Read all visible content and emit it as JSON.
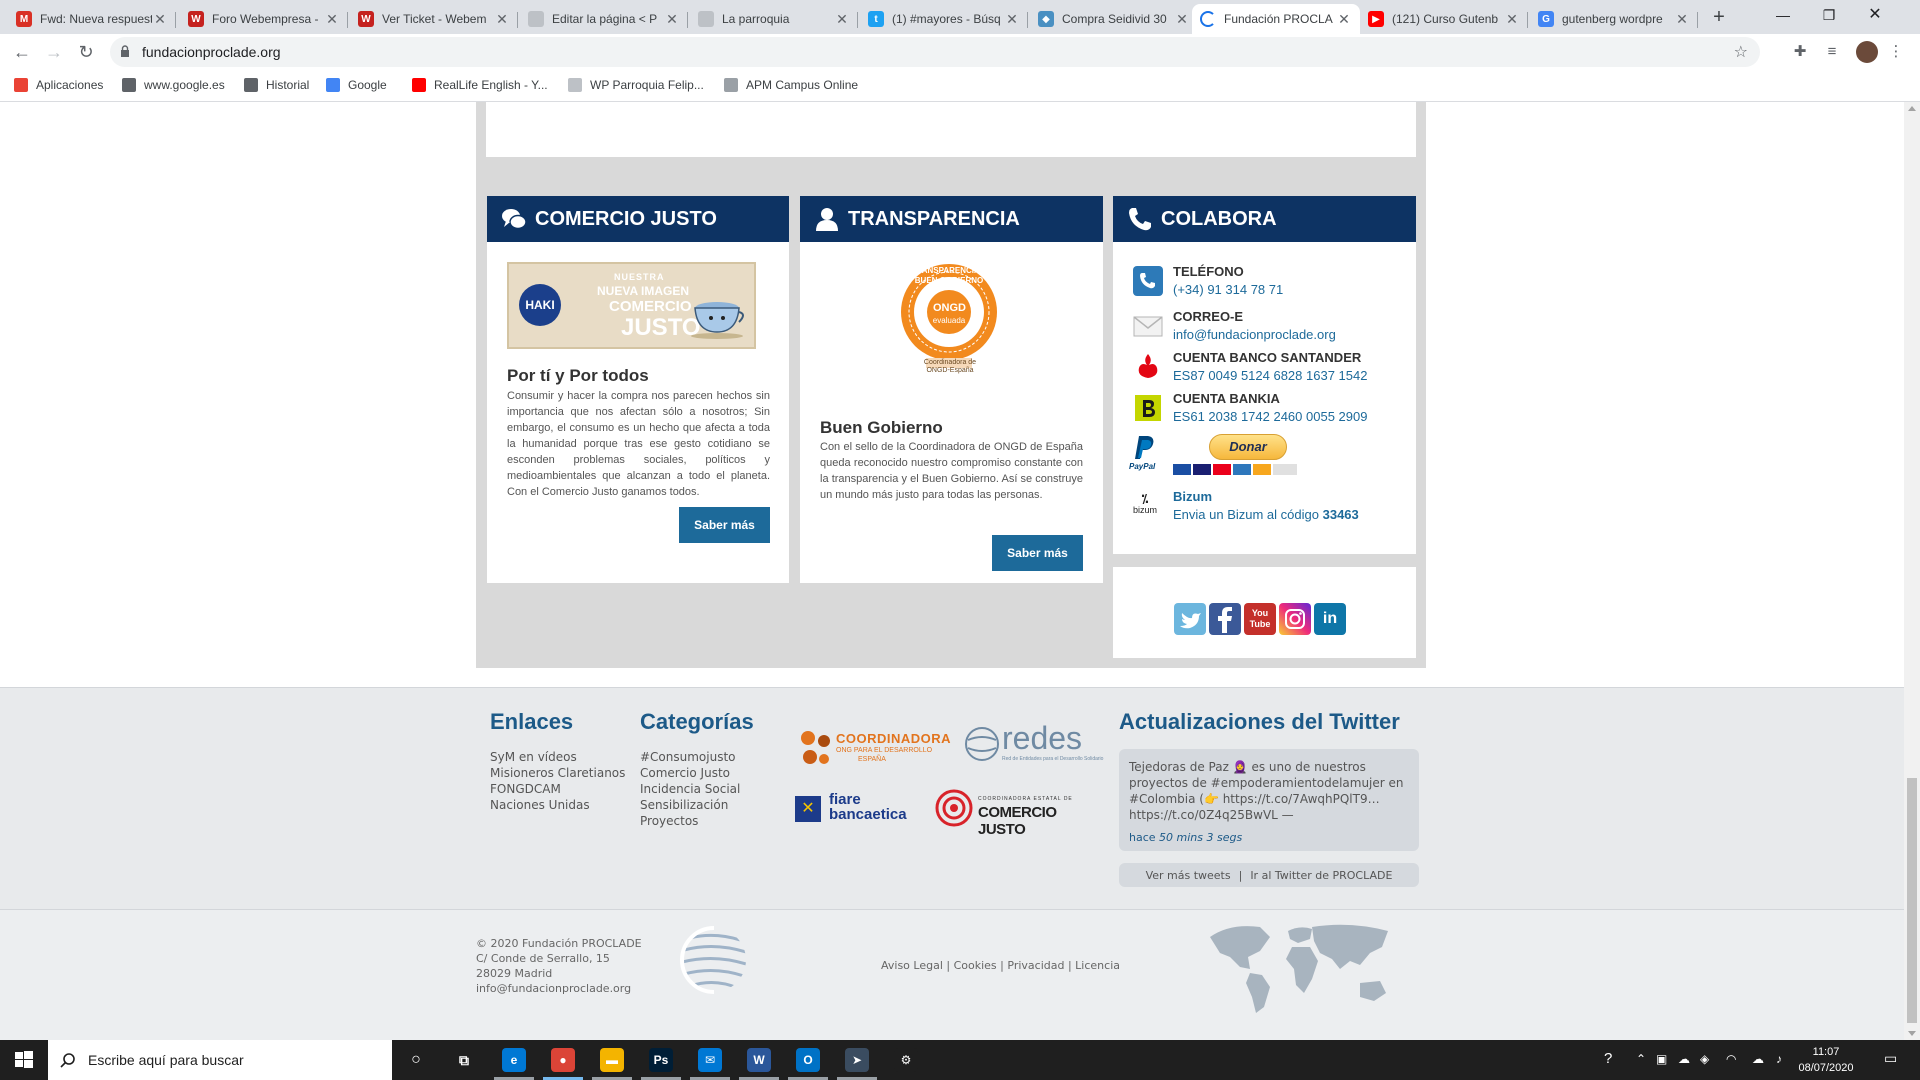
{
  "browser": {
    "tabs": [
      {
        "title": "Fwd: Nueva respuesta",
        "icon": "gmail-icon",
        "color": "#d93025",
        "glyph": "M"
      },
      {
        "title": "Foro Webempresa -",
        "icon": "webempresa-icon",
        "color": "#c5221f",
        "glyph": "W"
      },
      {
        "title": "Ver Ticket - Webem",
        "icon": "webempresa-icon",
        "color": "#c5221f",
        "glyph": "W"
      },
      {
        "title": "Editar la página < P",
        "icon": "page-icon",
        "color": "#bdc1c6",
        "glyph": ""
      },
      {
        "title": "La parroquia",
        "icon": "page-icon",
        "color": "#bdc1c6",
        "glyph": ""
      },
      {
        "title": "(1) #mayores - Búsq",
        "icon": "twitter-icon",
        "color": "#1da1f2",
        "glyph": "t"
      },
      {
        "title": "Compra Seidivid 30",
        "icon": "diamond-icon",
        "color": "#4a90c2",
        "glyph": "◆"
      },
      {
        "title": "Fundación PROCLA",
        "icon": "loading-icon",
        "color": "#ffffff",
        "glyph": "",
        "active": true
      },
      {
        "title": "(121) Curso Gutenb",
        "icon": "youtube-icon",
        "color": "#ff0000",
        "glyph": "▶"
      },
      {
        "title": "gutenberg wordpre",
        "icon": "google-icon",
        "color": "#4285f4",
        "glyph": "G"
      }
    ],
    "url": "fundacionproclade.org",
    "bookmarks": [
      {
        "label": "Aplicaciones",
        "icon": "apps-icon",
        "color": "#ea4335"
      },
      {
        "label": "www.google.es",
        "icon": "globe-icon",
        "color": "#5f6368"
      },
      {
        "label": "Historial",
        "icon": "history-icon",
        "color": "#5f6368"
      },
      {
        "label": "Google",
        "icon": "google-icon",
        "color": "#4285f4"
      },
      {
        "label": "RealLife English - Y...",
        "icon": "youtube-icon",
        "color": "#ff0000"
      },
      {
        "label": "WP Parroquia Felip...",
        "icon": "page-icon",
        "color": "#bdc1c6"
      },
      {
        "label": "APM Campus Online",
        "icon": "campus-icon",
        "color": "#9aa0a6"
      }
    ]
  },
  "cards": {
    "comercio": {
      "heading": "COMERCIO JUSTO",
      "banner_small": "NUESTRA",
      "banner_mid": "NUEVA IMAGEN",
      "banner_big": "COMERCIO",
      "banner_big2": "JUSTO",
      "banner_brand": "HAKI",
      "title": "Por tí y Por todos",
      "text": "Consumir y hacer la compra nos parecen hechos sin importancia que nos afectan sólo a nosotros; Sin embargo, el consumo es un hecho que afecta a toda la humanidad porque tras ese gesto cotidiano se esconden problemas sociales, políticos y medioambientales que alcanzan a todo el planeta. Con el Comercio Justo ganamos todos.",
      "button": "Saber más"
    },
    "transparencia": {
      "heading": "TRANSPARENCIA",
      "seal_ring": "TRANSPARENCIA Y BUEN GOBIERNO",
      "seal_center": "ONGD",
      "seal_center2": "evaluada",
      "seal_caption": "Coordinadora de ONGD-España",
      "title": "Buen Gobierno",
      "text": "Con el sello de la Coordinadora de ONGD de España queda reconocido nuestro compromiso constante con la transparencia y el Buen Gobierno. Así se construye un mundo más justo para todas las personas.",
      "button": "Saber más"
    },
    "colabora": {
      "heading": "COLABORA",
      "items": [
        {
          "label": "TELÉFONO",
          "value": "(+34) 91 314 78 71"
        },
        {
          "label": "CORREO-E",
          "value": "info@fundacionproclade.org"
        },
        {
          "label": "CUENTA BANCO SANTANDER",
          "value": "ES87 0049 5124 6828 1637 1542"
        },
        {
          "label": "CUENTA BANKIA",
          "value": "ES61 2038 1742 2460 0055 2909"
        }
      ],
      "paypal_label": "PayPal",
      "donate_button": "Donar",
      "bizum_label": "Bizum",
      "bizum_icon_text": "bizum",
      "bizum_text": "Envia un Bizum al código",
      "bizum_code": "33463"
    }
  },
  "social": [
    "twitter-icon",
    "facebook-icon",
    "youtube-icon",
    "instagram-icon",
    "linkedin-icon"
  ],
  "social_glyphs": {
    "youtube": "You Tube",
    "linkedin": "in"
  },
  "footer": {
    "enlaces": {
      "heading": "Enlaces",
      "items": [
        "SyM en vídeos",
        "Misioneros Claretianos",
        "FONGDCAM",
        "Naciones Unidas"
      ]
    },
    "categorias": {
      "heading": "Categorías",
      "items": [
        "#Consumojusto",
        "Comercio Justo",
        "Incidencia Social",
        "Sensibilización",
        "Proyectos"
      ]
    },
    "partners": {
      "coordinadora": "COORDINADORA",
      "coordinadora_sub": "ONG PARA EL DESARROLLO",
      "coordinadora_sub2": "ESPAÑA",
      "redes": "redes",
      "redes_sub": "Red de Entidades para el Desarrollo Solidario",
      "fiare": "fiare",
      "fiare2": "bancaetica",
      "cj_small": "COORDINADORA ESTATAL DE",
      "cj_big": "COMERCIO JUSTO"
    },
    "twitter": {
      "heading": "Actualizaciones del Twitter",
      "tweet": "Tejedoras de Paz 🧕 es uno de nuestros proyectos de #empoderamientodelamujer en #Colombia (👉 https://t.co/7AwqhPQlT9… https://t.co/0Z4q25BwVL —",
      "time_prefix": "hace",
      "time": "50 mins 3 segs",
      "more": "Ver más tweets",
      "go": "Ir al Twitter de PROCLADE"
    }
  },
  "copyright": {
    "line1": "© 2020 Fundación PROCLADE",
    "line2": "C/ Conde de Serrallo, 15",
    "line3": "28029 Madrid",
    "line4": "info@fundacionproclade.org",
    "legal": [
      "Aviso Legal",
      "Cookies",
      "Privacidad",
      "Licencia"
    ]
  },
  "taskbar": {
    "search_placeholder": "Escribe aquí para buscar",
    "time": "11:07",
    "date": "08/07/2020",
    "apps": [
      {
        "name": "edge-icon",
        "color": "#0078d4",
        "glyph": "e"
      },
      {
        "name": "chrome-icon",
        "color": "#db4437",
        "glyph": "●"
      },
      {
        "name": "explorer-icon",
        "color": "#f4b400",
        "glyph": "▬"
      },
      {
        "name": "photoshop-icon",
        "color": "#001e36",
        "glyph": "Ps"
      },
      {
        "name": "mail-icon",
        "color": "#0078d4",
        "glyph": "✉"
      },
      {
        "name": "word-icon",
        "color": "#2b579a",
        "glyph": "W"
      },
      {
        "name": "outlook-icon",
        "color": "#0072c6",
        "glyph": "O"
      },
      {
        "name": "app-icon",
        "color": "#3a4c60",
        "glyph": "➤"
      },
      {
        "name": "settings-icon",
        "color": "#1f1f1f",
        "glyph": "⚙"
      }
    ]
  },
  "colors": {
    "header_blue": "#0d3363",
    "link_blue": "#1d6a9a",
    "footer_heading": "#1d5a88"
  }
}
